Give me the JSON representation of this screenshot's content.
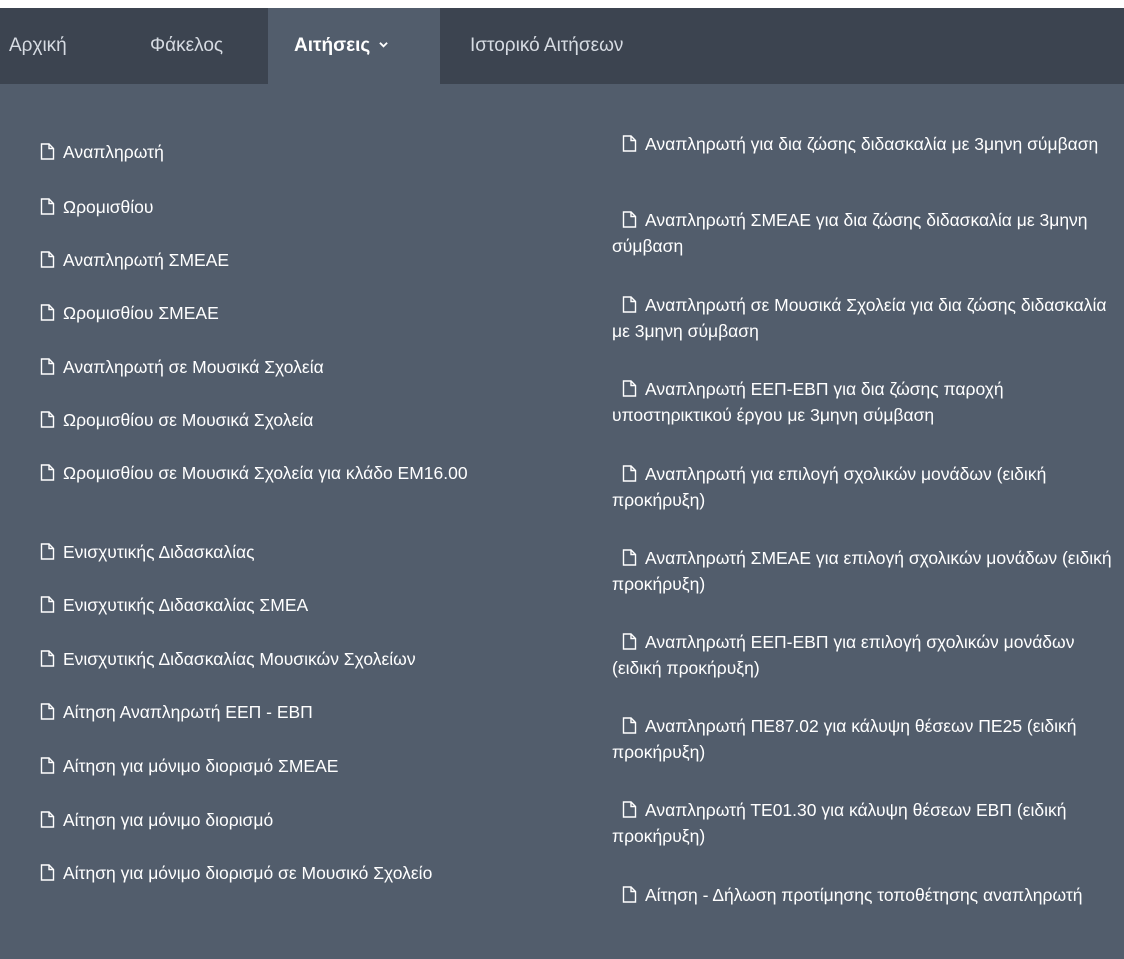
{
  "nav": {
    "items": [
      {
        "label": "Αρχική"
      },
      {
        "label": "Φάκελος"
      },
      {
        "label": "Αιτήσεις"
      },
      {
        "label": "Ιστορικό Αιτήσεων"
      }
    ]
  },
  "menu": {
    "left": [
      {
        "label": "Αναπληρωτή"
      },
      {
        "label": "Ωρομισθίου"
      },
      {
        "label": "Αναπληρωτή ΣΜΕΑΕ"
      },
      {
        "label": "Ωρομισθίου ΣΜΕΑΕ"
      },
      {
        "label": "Αναπληρωτή σε Μουσικά Σχολεία"
      },
      {
        "label": "Ωρομισθίου σε Μουσικά Σχολεία"
      },
      {
        "label": "Ωρομισθίου σε Μουσικά Σχολεία για κλάδο ΕΜ16.00"
      },
      {
        "label": "Ενισχυτικής Διδασκαλίας"
      },
      {
        "label": "Ενισχυτικής Διδασκαλίας ΣΜΕΑ"
      },
      {
        "label": "Ενισχυτικής Διδασκαλίας Μουσικών Σχολείων"
      },
      {
        "label": "Αίτηση Αναπληρωτή ΕΕΠ - ΕΒΠ"
      },
      {
        "label": "Αίτηση για μόνιμο διορισμό ΣΜΕΑΕ"
      },
      {
        "label": "Αίτηση για μόνιμο διορισμό"
      },
      {
        "label": "Αίτηση για μόνιμο διορισμό σε Μουσικό Σχολείο"
      }
    ],
    "right": [
      {
        "label": "Αναπληρωτή για δια ζώσης διδασκαλία με 3μηνη σύμβαση"
      },
      {
        "label": "Αναπληρωτή ΣΜΕΑΕ για δια ζώσης διδασκαλία με 3μηνη σύμβαση"
      },
      {
        "label": "Αναπληρωτή σε Μουσικά Σχολεία για δια ζώσης διδασκαλία με 3μηνη σύμβαση"
      },
      {
        "label": "Αναπληρωτή ΕΕΠ-ΕΒΠ για δια ζώσης παροχή υποστηρικτικού έργου με 3μηνη σύμβαση"
      },
      {
        "label": "Αναπληρωτή για επιλογή σχολικών μονάδων (ειδική προκήρυξη)"
      },
      {
        "label": "Αναπληρωτή ΣΜΕΑΕ για επιλογή σχολικών μονάδων (ειδική προκήρυξη)"
      },
      {
        "label": "Αναπληρωτή ΕΕΠ-ΕΒΠ για επιλογή σχολικών μονάδων (ειδική προκήρυξη)"
      },
      {
        "label": "Αναπληρωτή ΠΕ87.02 για κάλυψη θέσεων ΠΕ25 (ειδική προκήρυξη)"
      },
      {
        "label": "Αναπληρωτή ΤΕ01.30 για κάλυψη θέσεων ΕΒΠ (ειδική προκήρυξη)"
      },
      {
        "label": "Αίτηση - Δήλωση προτίμησης τοποθέτησης αναπληρωτή"
      }
    ]
  },
  "icons": {
    "item_icon": "file-icon",
    "nav_caret": "chevron-down-icon"
  },
  "colors": {
    "navbar": "#3c4450",
    "menu_bg": "#525d6c",
    "text": "#ffffff"
  }
}
